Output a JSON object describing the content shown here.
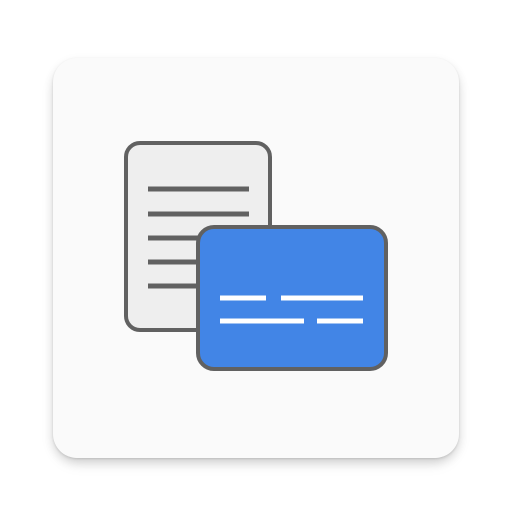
{
  "app_icon": {
    "icon_name": "document-with-card-icon",
    "colors": {
      "background": "#fafafa",
      "document_fill": "#eeeeee",
      "outline": "#616161",
      "line": "#616161",
      "card_fill": "#4285e6",
      "card_line": "#ffffff"
    }
  }
}
